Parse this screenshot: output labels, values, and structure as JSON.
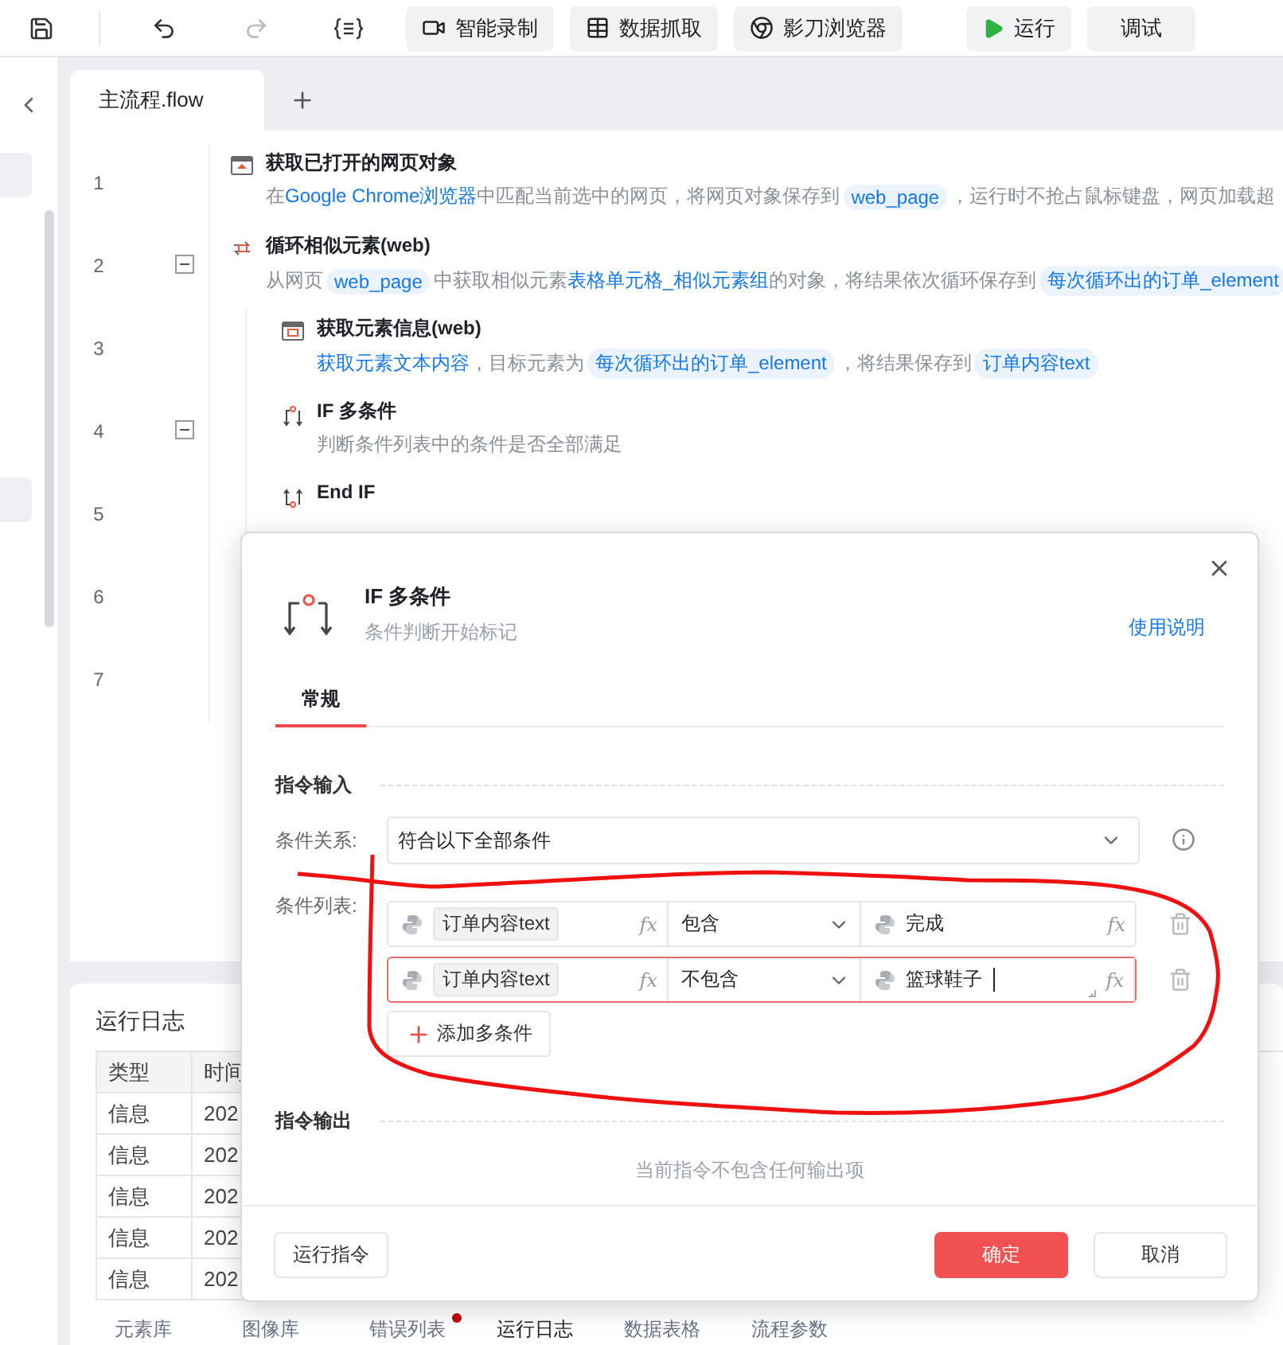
{
  "toolbar": [
    {
      "kind": "icon",
      "disabled": false
    },
    {
      "kind": "icon",
      "disabled": false
    },
    {
      "kind": "icon",
      "disabled": true
    },
    {
      "kind": "icon",
      "disabled": false
    },
    {
      "kind": "button",
      "label": "智能录制"
    },
    {
      "kind": "button",
      "label": "数据抓取"
    },
    {
      "kind": "button",
      "label": "影刀浏览器"
    },
    {
      "kind": "button",
      "label": "运行"
    },
    {
      "kind": "button",
      "label": "调试"
    }
  ],
  "editor_tabs": [
    {
      "label": "主流程.flow",
      "selected": true
    }
  ],
  "steps": [
    {
      "number": "1",
      "title": "获取已打开的网页对象",
      "description": [
        {
          "kind": "text",
          "text": "在"
        },
        {
          "kind": "link",
          "text": "Google Chrome浏览器"
        },
        {
          "kind": "text",
          "text": "中匹配当前选中的网页，将网页对象保存到"
        },
        {
          "kind": "var",
          "text": "web_page"
        },
        {
          "kind": "text",
          "text": "，运行时不抢占鼠标键盘，网页加载超"
        }
      ]
    },
    {
      "number": "2",
      "title": "循环相似元素(web)",
      "expanded": true,
      "description": [
        {
          "kind": "text",
          "text": "从网页"
        },
        {
          "kind": "var",
          "text": "web_page"
        },
        {
          "kind": "text",
          "text": "中获取相似元素"
        },
        {
          "kind": "link",
          "text": "表格单元格_相似元素组"
        },
        {
          "kind": "text",
          "text": "的对象，将结果依次循环保存到"
        },
        {
          "kind": "var",
          "text": "每次循环出的订单_element"
        }
      ],
      "children": [
        {
          "number": "3",
          "title": "获取元素信息(web)",
          "description": [
            {
              "kind": "link",
              "text": "获取元素文本内容"
            },
            {
              "kind": "text",
              "text": "，目标元素为"
            },
            {
              "kind": "var",
              "text": "每次循环出的订单_element"
            },
            {
              "kind": "text",
              "text": "，将结果保存到"
            },
            {
              "kind": "var",
              "text": "订单内容text"
            }
          ]
        },
        {
          "number": "4",
          "title": "IF 多条件",
          "expanded": true,
          "description": [
            {
              "kind": "muted",
              "text": "判断条件列表中的条件是否全部满足"
            }
          ]
        },
        {
          "number": "5",
          "title": "End IF"
        },
        {
          "number": "6"
        }
      ]
    },
    {
      "number": "7"
    }
  ],
  "log_panel": {
    "title": "运行日志",
    "columns": [
      "类型",
      "时间"
    ],
    "rows": [
      [
        "信息",
        "202"
      ],
      [
        "信息",
        "202"
      ],
      [
        "信息",
        "202"
      ],
      [
        "信息",
        "202"
      ],
      [
        "信息",
        "202"
      ]
    ]
  },
  "bottom_tabs": [
    {
      "label": "元素库",
      "selected": false,
      "alert": false
    },
    {
      "label": "图像库",
      "selected": false,
      "alert": false
    },
    {
      "label": "错误列表",
      "selected": false,
      "alert": true
    },
    {
      "label": "运行日志",
      "selected": true,
      "alert": false
    },
    {
      "label": "数据表格",
      "selected": false,
      "alert": false
    },
    {
      "label": "流程参数",
      "selected": false,
      "alert": false
    }
  ],
  "dialog": {
    "title": "IF 多条件",
    "subtitle": "条件判断开始标记",
    "help_link": "使用说明",
    "tabs": [
      {
        "label": "常规",
        "selected": true
      }
    ],
    "input_section": {
      "title": "指令输入",
      "relation": {
        "label": "条件关系:",
        "value": "符合以下全部条件"
      },
      "conditions": {
        "label": "条件列表:",
        "rows": [
          {
            "variable": "订单内容text",
            "variable_fx": "fx",
            "operator": "包含",
            "value": "完成",
            "value_fx": "fx",
            "focused": false
          },
          {
            "variable": "订单内容text",
            "variable_fx": "fx",
            "operator": "不包含",
            "value": "篮球鞋子",
            "value_fx": "fx",
            "focused": true
          }
        ],
        "add_button": "添加多条件"
      }
    },
    "output_section": {
      "title": "指令输出",
      "empty_text": "当前指令不包含任何输出项"
    },
    "footer": {
      "run_button": "运行指令",
      "ok_button": "确定",
      "cancel_button": "取消"
    }
  }
}
